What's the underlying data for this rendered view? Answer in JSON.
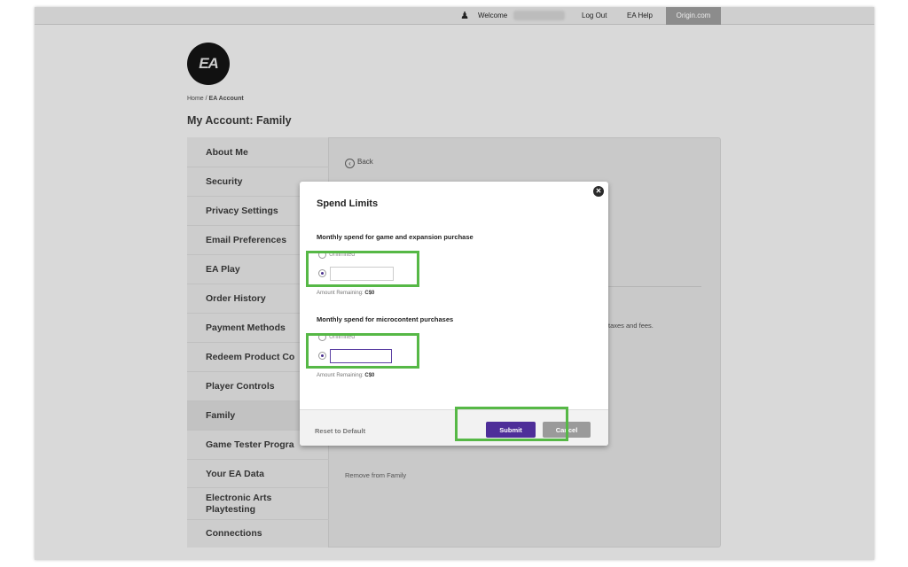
{
  "topbar": {
    "welcome": "Welcome",
    "logout": "Log Out",
    "help": "EA Help",
    "origin": "Origin.com",
    "user_icon": "user-icon"
  },
  "logo": {
    "text": "EA"
  },
  "breadcrumb": {
    "home": "Home",
    "separator": " / ",
    "current": "EA Account"
  },
  "page_title": "My Account: Family",
  "sidebar": {
    "items": [
      {
        "label": "About Me"
      },
      {
        "label": "Security"
      },
      {
        "label": "Privacy Settings"
      },
      {
        "label": "Email Preferences"
      },
      {
        "label": "EA Play"
      },
      {
        "label": "Order History"
      },
      {
        "label": "Payment Methods"
      },
      {
        "label": "Redeem Product Co"
      },
      {
        "label": "Player Controls"
      },
      {
        "label": "Family",
        "active": true
      },
      {
        "label": "Game Tester Progra"
      },
      {
        "label": "Your EA Data"
      },
      {
        "label": "Electronic Arts Playtesting"
      },
      {
        "label": "Connections"
      }
    ]
  },
  "content": {
    "back": "Back",
    "background_text": "taxes and fees.",
    "remove": "Remove from Family"
  },
  "modal": {
    "title": "Spend Limits",
    "section1": {
      "label": "Monthly spend for game and expansion purchase",
      "option_unlimited": "Unlimited",
      "input_value": "",
      "remaining_label": "Amount Remaining:",
      "remaining_value": "C$0"
    },
    "section2": {
      "label": "Monthly spend for microcontent purchases",
      "option_unlimited": "Unlimited",
      "input_value": "",
      "remaining_label": "Amount Remaining:",
      "remaining_value": "C$0"
    },
    "reset": "Reset to Default",
    "submit": "Submit",
    "cancel": "Cancel"
  },
  "colors": {
    "highlight": "#56b846",
    "primary_button": "#4e2e99"
  }
}
